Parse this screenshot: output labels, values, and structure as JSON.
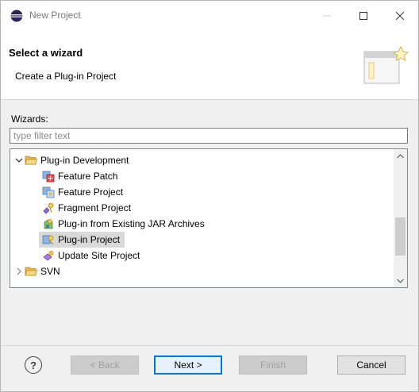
{
  "window": {
    "title": "New Project",
    "colors": {
      "accent": "#0078d7",
      "selection": "#d9d9d9",
      "folder": "#e8b84a"
    }
  },
  "banner": {
    "title": "Select a wizard",
    "description": "Create a Plug-in Project"
  },
  "wizards": {
    "label": "Wizards:",
    "filter_placeholder": "type filter text",
    "filter_value": ""
  },
  "tree": {
    "items": [
      {
        "label": "Plug-in Development",
        "icon": "folder-open-icon",
        "expanded": true
      },
      {
        "label": "Feature Patch",
        "icon": "feature-patch-icon"
      },
      {
        "label": "Feature Project",
        "icon": "feature-project-icon"
      },
      {
        "label": "Fragment Project",
        "icon": "fragment-project-icon"
      },
      {
        "label": "Plug-in from Existing JAR Archives",
        "icon": "plugin-jar-icon"
      },
      {
        "label": "Plug-in Project",
        "icon": "plugin-project-icon",
        "selected": true
      },
      {
        "label": "Update Site Project",
        "icon": "update-site-icon"
      },
      {
        "label": "SVN",
        "icon": "folder-icon",
        "expanded": false
      }
    ],
    "scroll_position": 0.5
  },
  "footer": {
    "help_label": "?",
    "back_label": "< Back",
    "next_label": "Next >",
    "finish_label": "Finish",
    "cancel_label": "Cancel"
  }
}
